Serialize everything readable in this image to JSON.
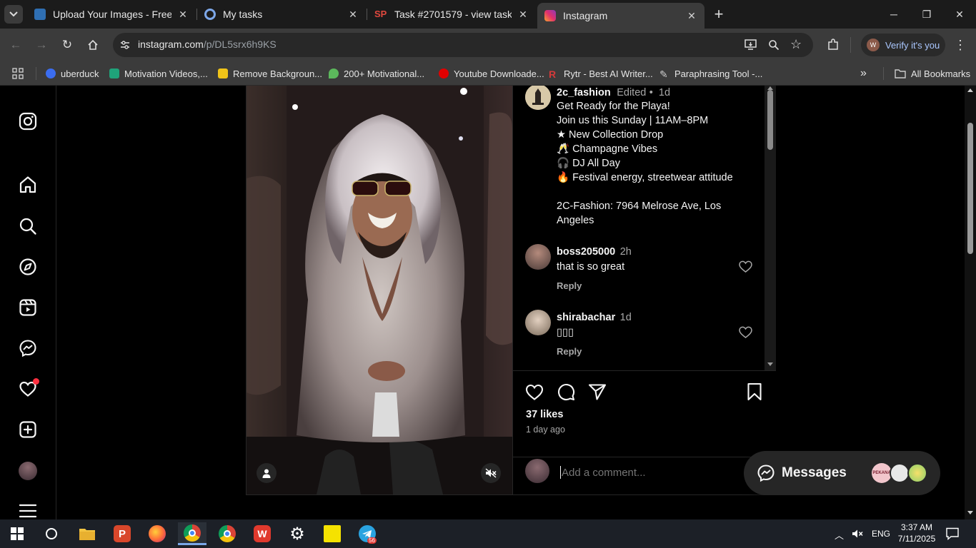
{
  "browser": {
    "tabs": [
      {
        "title": "Upload Your Images - Free Ima",
        "favicon_color": "#4a90d9"
      },
      {
        "title": "My tasks",
        "favicon_color": "#4a78c2"
      },
      {
        "title": "Task #2701579 - view task",
        "favicon_color": "#e0483e"
      },
      {
        "title": "Instagram",
        "favicon_color": "#e1306c"
      }
    ],
    "close_glyph": "✕",
    "url": {
      "host": "instagram.com",
      "path": "/p/DL5srx6h9KS"
    },
    "profile_initial": "W",
    "verify_label": "Verify it's you",
    "bookmarks": [
      {
        "label": "uberduck",
        "color": "#3b6df0"
      },
      {
        "label": "Motivation Videos,...",
        "color": "#1fa37a"
      },
      {
        "label": "Remove Backgroun...",
        "color": "#f0c419"
      },
      {
        "label": "200+ Motivational...",
        "color": "#5cb85c"
      },
      {
        "label": "Youtube Downloade...",
        "color": "#e00000"
      },
      {
        "label": "Rytr - Best AI Writer...",
        "color": "#d43a3a"
      },
      {
        "label": "Paraphrasing Tool -...",
        "color": "#cccccc"
      }
    ],
    "all_bookmarks_label": "All Bookmarks"
  },
  "post": {
    "author": "2c_fashion",
    "edited": "Edited",
    "age": "1d",
    "caption": "Get Ready for the Playa!\nJoin us this Sunday | 11AM–8PM\n★ New Collection Drop\n🥂 Champagne Vibes\n🎧 DJ All Day\n🔥 Festival energy, streetwear attitude\n\n2C-Fashion: 7964 Melrose Ave, Los Angeles",
    "comments": [
      {
        "user": "boss205000",
        "age": "2h",
        "text": "that is so great",
        "reply_label": "Reply"
      },
      {
        "user": "shirabachar",
        "age": "1d",
        "text": "▯▯▯",
        "reply_label": "Reply"
      }
    ],
    "likes": "37 likes",
    "posted": "1 day ago",
    "comment_placeholder": "Add a comment..."
  },
  "messages": {
    "label": "Messages",
    "avatar_texts": [
      "PEKANA",
      "",
      ""
    ]
  },
  "taskbar": {
    "telegram_badge": "56",
    "tray_lang": "ENG",
    "time": "3:37 AM",
    "date": "7/11/2025"
  }
}
